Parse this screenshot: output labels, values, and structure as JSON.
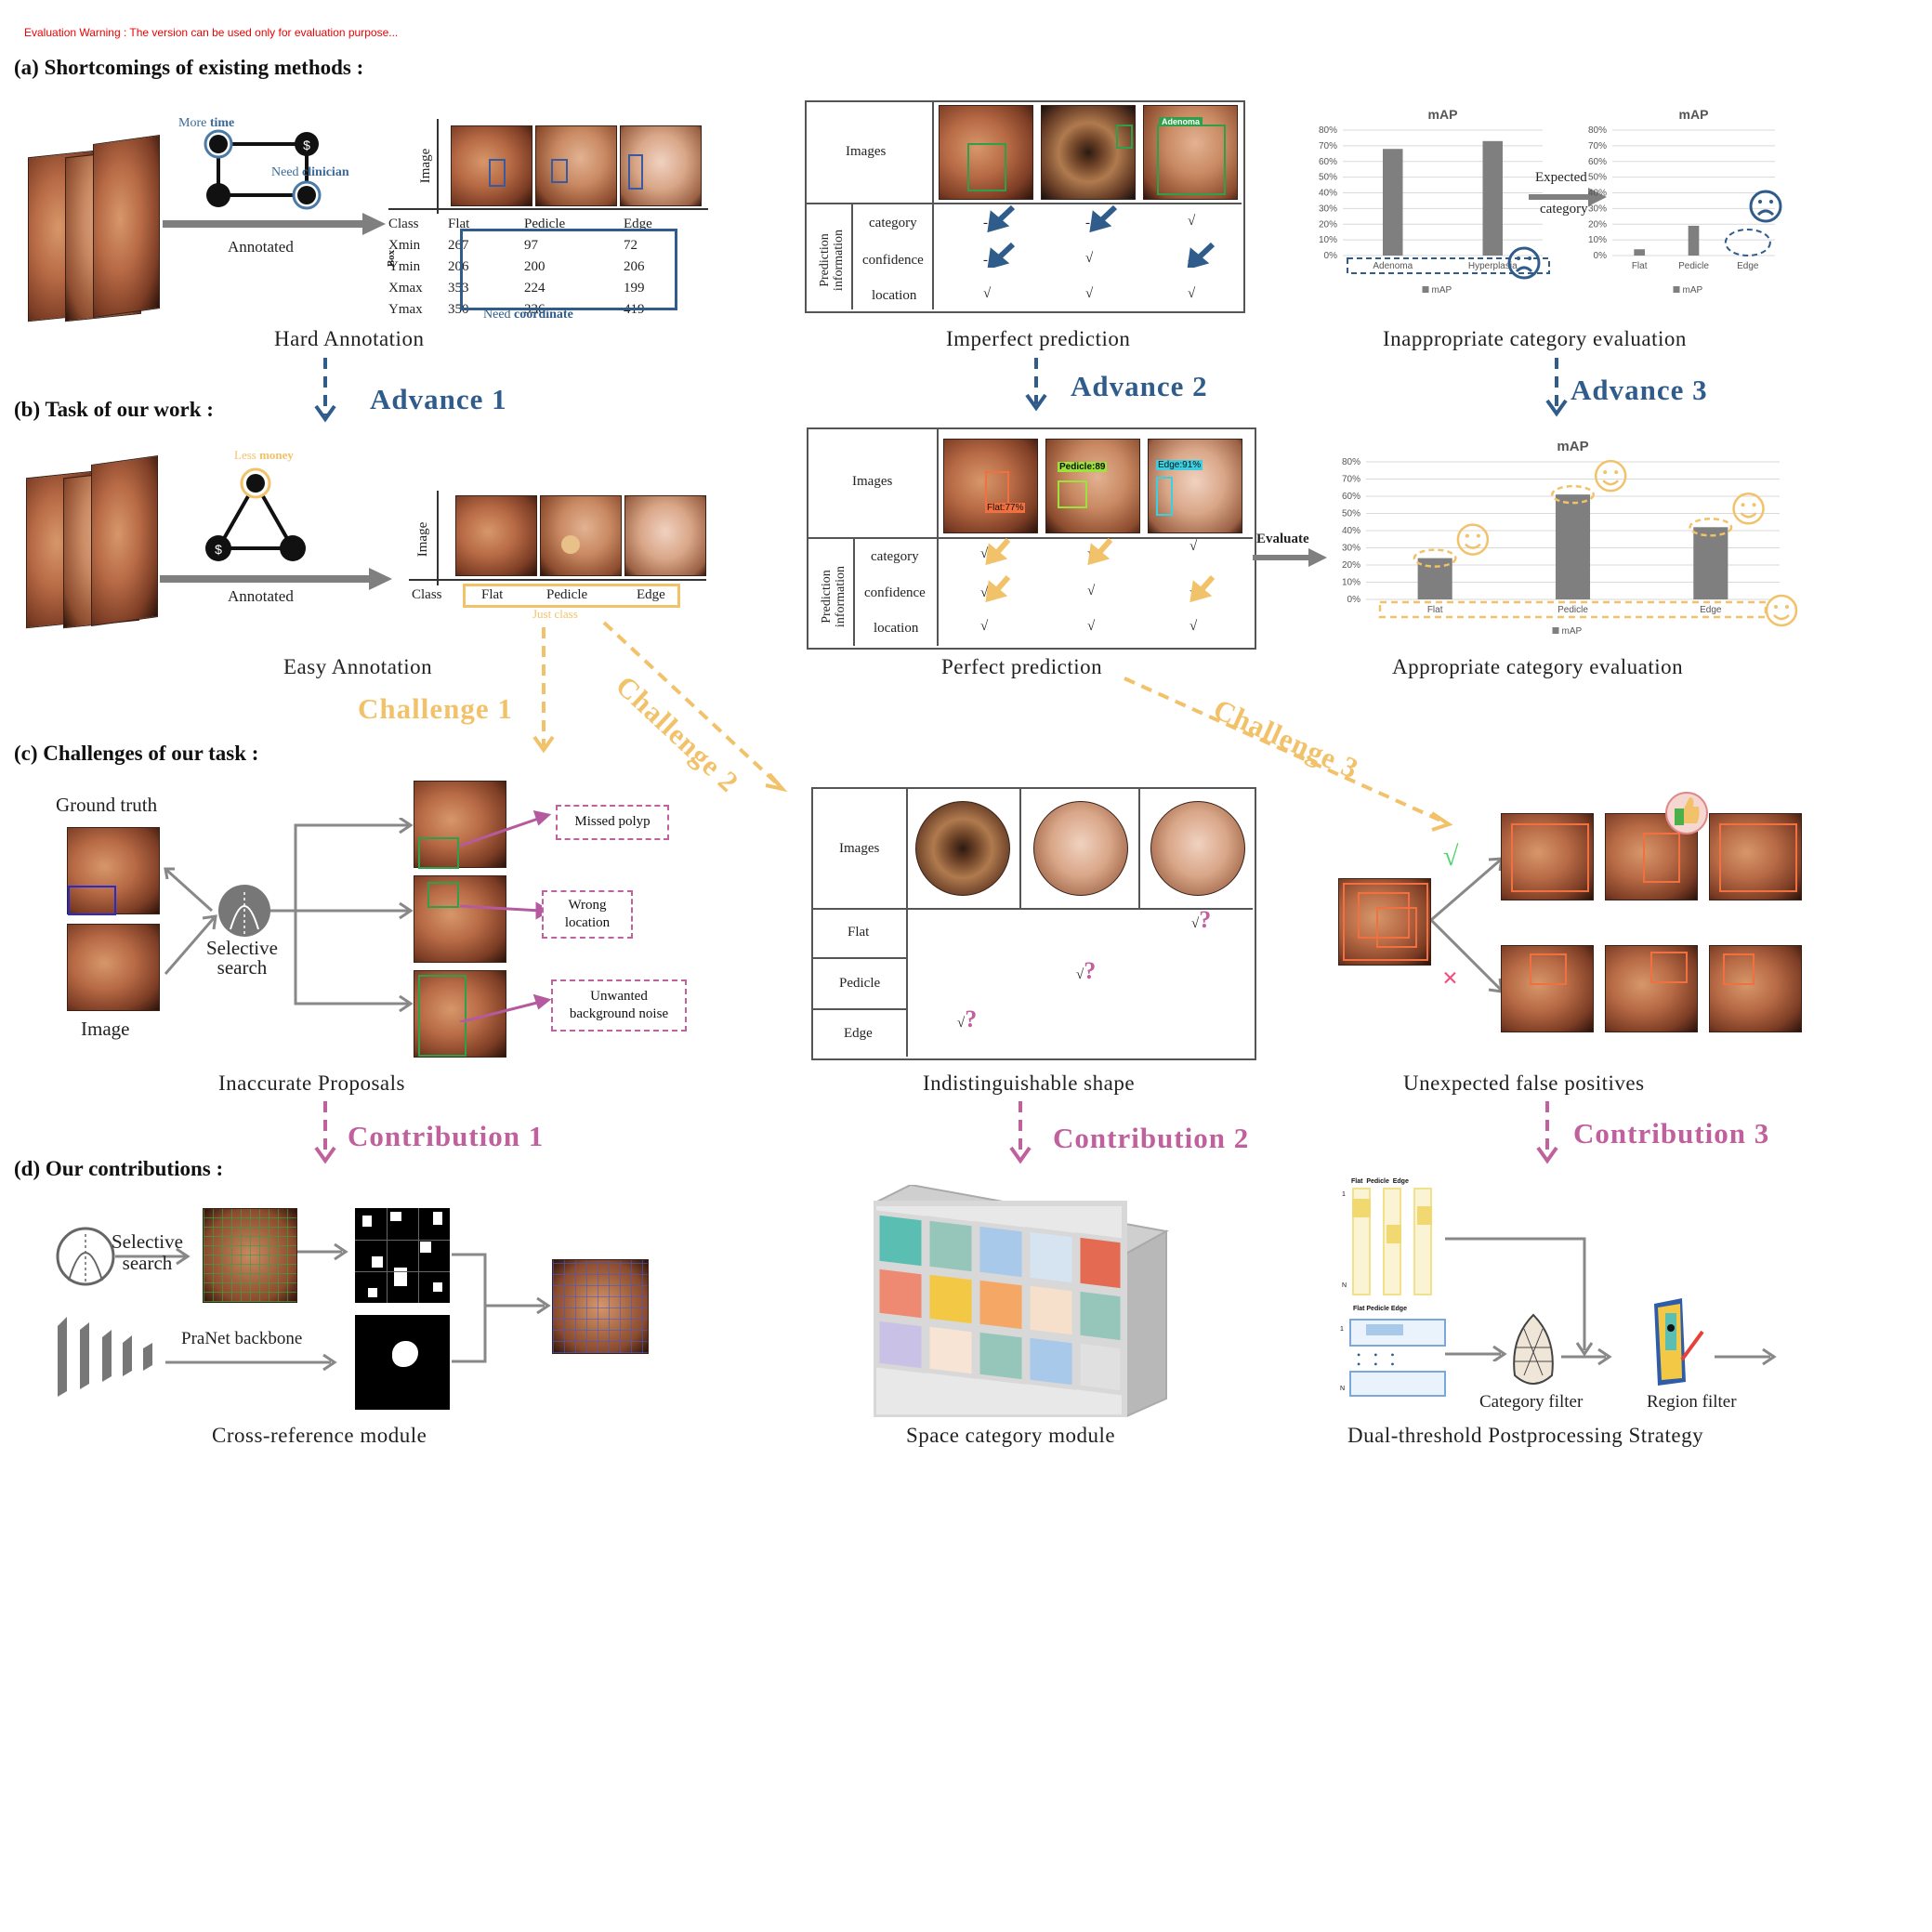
{
  "warning": "Evaluation Warning : The version can be used only for evaluation purpose...",
  "sections": {
    "a": "(a)  Shortcomings of existing methods :",
    "b": "(b)  Task of our work :",
    "c": "(c)  Challenges of our task :",
    "d": "(d)  Our contributions :"
  },
  "hard_annotation": {
    "more": "More ",
    "time": "time",
    "need": "Need ",
    "clinician": "clinician",
    "annotated": "Annotated",
    "image_label": "Image",
    "box_label": "Box",
    "need_coordinate_prefix": "Need ",
    "need_coordinate": "coordinate",
    "header": [
      "Class",
      "Flat",
      "Pedicle",
      "Edge"
    ],
    "rows": [
      [
        "Xmin",
        "267",
        "97",
        "72"
      ],
      [
        "Ymin",
        "206",
        "200",
        "206"
      ],
      [
        "Xmax",
        "353",
        "224",
        "199"
      ],
      [
        "Ymax",
        "350",
        "336",
        "419"
      ]
    ],
    "caption": "Hard Annotation"
  },
  "imperfect": {
    "images_label": "Images",
    "pred_info": "Prediction information",
    "rows": [
      "category",
      "confidence",
      "location"
    ],
    "check": "√",
    "dash": "-",
    "adenoma_tag": "Adenoma",
    "caption": "Imperfect prediction"
  },
  "inappropriate": {
    "chart1_title": "mAP",
    "chart2_title": "mAP",
    "expected": "Expected",
    "category": "category",
    "legend": "mAP",
    "caption": "Inappropriate category evaluation"
  },
  "advances": [
    "Advance 1",
    "Advance 2",
    "Advance 3"
  ],
  "easy_annotation": {
    "less": "Less ",
    "money": "money",
    "annotated": "Annotated",
    "image_label": "Image",
    "class_label": "Class",
    "classes": [
      "Flat",
      "Pedicle",
      "Edge"
    ],
    "just_class": "Just class",
    "caption": "Easy Annotation"
  },
  "perfect": {
    "images_label": "Images",
    "pred_info": "Prediction information",
    "rows": [
      "category",
      "confidence",
      "location"
    ],
    "check": "√",
    "tags": [
      "Flat:77%",
      "Pedicle:89",
      "Edge:91%"
    ],
    "evaluate": "Evaluate",
    "caption": "Perfect prediction"
  },
  "appropriate": {
    "title": "mAP",
    "legend": "mAP",
    "caption": "Appropriate category evaluation"
  },
  "challenges": [
    "Challenge 1",
    "Challenge 2",
    "Challenge 3"
  ],
  "proposals": {
    "ground_truth": "Ground truth",
    "image": "Image",
    "selective": "Selective",
    "search": "search",
    "missed": "Missed polyp",
    "wrong1": "Wrong",
    "wrong2": "location",
    "unwanted1": "Unwanted",
    "unwanted2": "background noise",
    "caption": "Inaccurate Proposals"
  },
  "shape": {
    "images_label": "Images",
    "rows": [
      "Flat",
      "Pedicle",
      "Edge"
    ],
    "mark": "√",
    "q": "?",
    "caption": "Indistinguishable shape"
  },
  "fp": {
    "caption": "Unexpected false positives"
  },
  "contributions": [
    "Contribution 1",
    "Contribution 2",
    "Contribution 3"
  ],
  "crossref": {
    "selective": "Selective",
    "search": "search",
    "backbone": "PraNet backbone",
    "caption": "Cross-reference module"
  },
  "space": {
    "caption": "Space category module"
  },
  "dual": {
    "cols": "Flat  Pedicle  Edge",
    "cols2": "Flat Pedicle Edge",
    "row1": "1",
    "rowN": "N",
    "category_filter": "Category filter",
    "region_filter": "Region filter",
    "caption": "Dual-threshold Postprocessing Strategy"
  },
  "chart_data": [
    {
      "type": "bar",
      "title": "mAP",
      "categories": [
        "Adenoma",
        "Hyperplasia"
      ],
      "series": [
        {
          "name": "mAP",
          "values": [
            68,
            73
          ]
        }
      ],
      "yticks": [
        "0%",
        "10%",
        "20%",
        "30%",
        "40%",
        "50%",
        "60%",
        "70%",
        "80%"
      ],
      "ylim": [
        0,
        80
      ]
    },
    {
      "type": "bar",
      "title": "mAP",
      "categories": [
        "Flat",
        "Pedicle",
        "Edge"
      ],
      "series": [
        {
          "name": "mAP",
          "values": [
            4,
            19,
            0
          ]
        }
      ],
      "yticks": [
        "0%",
        "10%",
        "20%",
        "30%",
        "40%",
        "50%",
        "60%",
        "70%",
        "80%"
      ],
      "ylim": [
        0,
        80
      ]
    },
    {
      "type": "bar",
      "title": "mAP",
      "categories": [
        "Flat",
        "Pedicle",
        "Edge"
      ],
      "series": [
        {
          "name": "mAP",
          "values": [
            24,
            61,
            42
          ]
        }
      ],
      "yticks": [
        "0%",
        "10%",
        "20%",
        "30%",
        "40%",
        "50%",
        "60%",
        "70%",
        "80%"
      ],
      "ylim": [
        0,
        80
      ]
    }
  ],
  "colors": {
    "advance": "#2f5c8a",
    "challenge": "#f2c26b",
    "contribution": "#c0609c",
    "bar": "#7f7f7f"
  }
}
